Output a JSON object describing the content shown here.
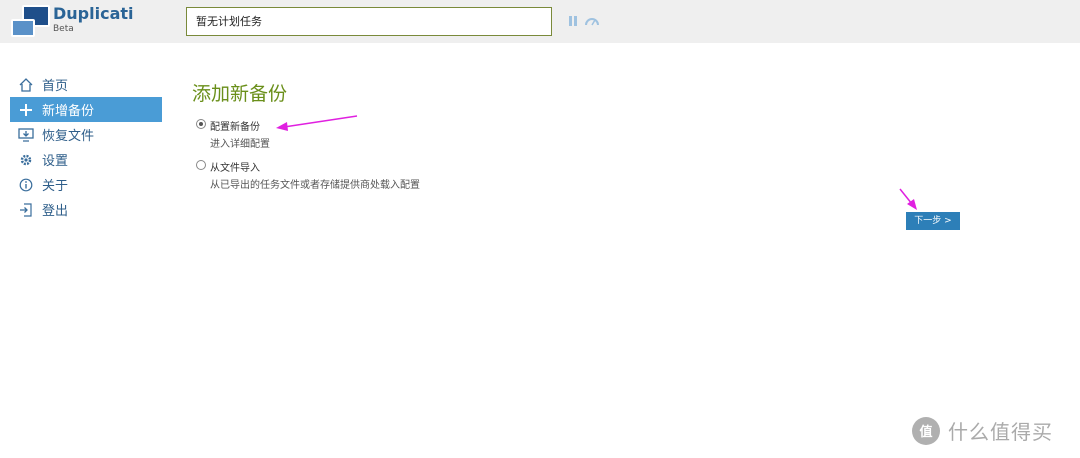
{
  "app": {
    "name": "Duplicati",
    "tag": "Beta"
  },
  "status": {
    "text": "暂无计划任务"
  },
  "sidebar": {
    "items": [
      {
        "label": "首页",
        "icon": "home-icon",
        "active": false
      },
      {
        "label": "新增备份",
        "icon": "plus-icon",
        "active": true
      },
      {
        "label": "恢复文件",
        "icon": "restore-icon",
        "active": false
      },
      {
        "label": "设置",
        "icon": "gear-icon",
        "active": false
      },
      {
        "label": "关于",
        "icon": "info-icon",
        "active": false
      },
      {
        "label": "登出",
        "icon": "logout-icon",
        "active": false
      }
    ]
  },
  "main": {
    "title": "添加新备份",
    "options": [
      {
        "label": "配置新备份",
        "description": "进入详细配置",
        "selected": true
      },
      {
        "label": "从文件导入",
        "description": "从已导出的任务文件或者存储提供商处载入配置",
        "selected": false
      }
    ],
    "next_label": "下一步 >"
  },
  "watermark": {
    "logo_char": "值",
    "text": "什么值得买"
  },
  "colors": {
    "accent": "#4a9cd6",
    "title": "#6a8f1a",
    "button": "#2d7fb8",
    "annotation_arrow": "#e020e0"
  }
}
